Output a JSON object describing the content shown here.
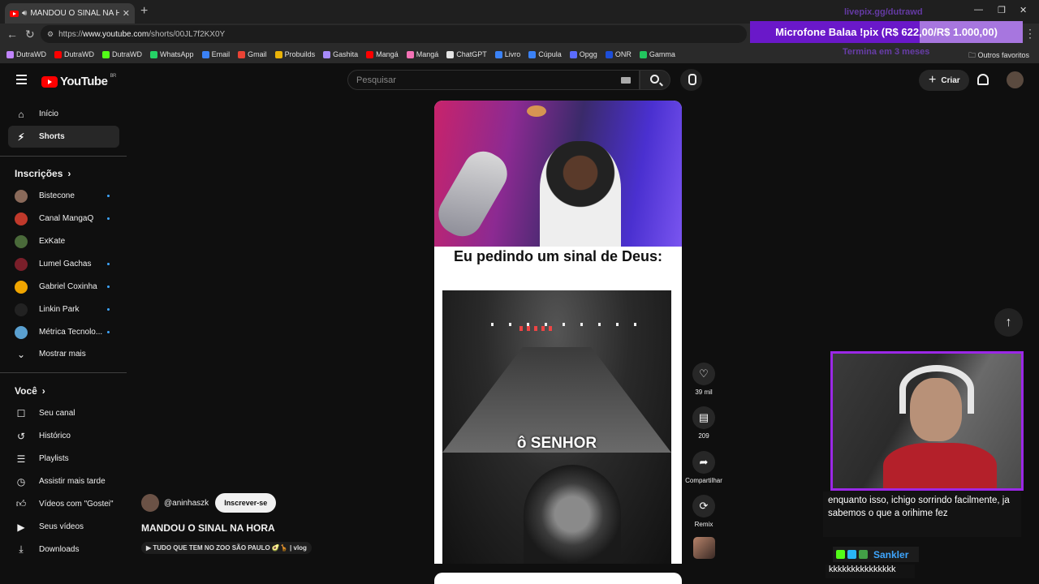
{
  "browser": {
    "tab_title": "MANDOU O SINAL NA HORA",
    "url_prefix": "https://",
    "url_host": "www.youtube.com",
    "url_path": "/shorts/00JL7f2KX0Y",
    "bookmarks": [
      {
        "label": "DutraWD",
        "color": "#c084fc"
      },
      {
        "label": "DutraWD",
        "color": "#ff0000"
      },
      {
        "label": "DutraWD",
        "color": "#53fc18"
      },
      {
        "label": "WhatsApp",
        "color": "#25d366"
      },
      {
        "label": "Email",
        "color": "#3b82f6"
      },
      {
        "label": "Gmail",
        "color": "#ea4335"
      },
      {
        "label": "Probuilds",
        "color": "#eab308"
      },
      {
        "label": "Gashita",
        "color": "#a78bfa"
      },
      {
        "label": "Mangá",
        "color": "#ff0000"
      },
      {
        "label": "Mangá",
        "color": "#f472b6"
      },
      {
        "label": "ChatGPT",
        "color": "#e5e5e5"
      },
      {
        "label": "Livro",
        "color": "#3b82f6"
      },
      {
        "label": "Cúpula",
        "color": "#3b82f6"
      },
      {
        "label": "Opgg",
        "color": "#5b6cff"
      },
      {
        "label": "ONR",
        "color": "#1d4ed8"
      },
      {
        "label": "Gamma",
        "color": "#22c55e"
      }
    ],
    "other_favorites": "Outros favoritos"
  },
  "overlay": {
    "donation_text": "Microfone Balaa !pix (R$ 622,00/R$ 1.000,00)",
    "donation_progress": 0.622,
    "ghost_top": "livepix.gg/dutrawd",
    "ghost_bottom": "Termina em 3 meses"
  },
  "header": {
    "logo": "YouTube",
    "country": "BR",
    "search_placeholder": "Pesquisar",
    "create_label": "Criar"
  },
  "sidebar": {
    "main": [
      {
        "label": "Início",
        "icon": "home-icon"
      },
      {
        "label": "Shorts",
        "icon": "shorts-icon"
      }
    ],
    "subs_heading": "Inscrições",
    "subscriptions": [
      {
        "label": "Bistecone",
        "color": "#8a6a5a",
        "new": true
      },
      {
        "label": "Canal MangaQ",
        "color": "#c0392b",
        "new": true
      },
      {
        "label": "ExKate",
        "color": "#4a6a3a",
        "new": false
      },
      {
        "label": "Lumel Gachas",
        "color": "#7a1f2a",
        "new": true
      },
      {
        "label": "Gabriel Coxinha",
        "color": "#f0a500",
        "new": true
      },
      {
        "label": "Linkin Park",
        "color": "#222222",
        "new": true
      },
      {
        "label": "Métrica Tecnolo...",
        "color": "#5aa0d0",
        "new": true
      }
    ],
    "show_more": "Mostrar mais",
    "you_heading": "Você",
    "you": [
      {
        "label": "Seu canal",
        "icon": "channel-icon"
      },
      {
        "label": "Histórico",
        "icon": "history-icon"
      },
      {
        "label": "Playlists",
        "icon": "playlist-icon"
      },
      {
        "label": "Assistir mais tarde",
        "icon": "clock-icon"
      },
      {
        "label": "Vídeos com \"Gostei\"",
        "icon": "thumb-up-icon"
      },
      {
        "label": "Seus vídeos",
        "icon": "video-icon"
      },
      {
        "label": "Downloads",
        "icon": "download-icon"
      }
    ]
  },
  "short": {
    "meme_caption": "Eu pedindo um sinal de Deus:",
    "subtitle": "ô SENHOR",
    "channel": "@aninhaszk",
    "subscribe_label": "Inscrever-se",
    "title": "MANDOU O SINAL NA HORA",
    "linked_video": "▶ TUDO QUE TEM NO ZOO SÃO PAULO 🥑🦒 | vlog"
  },
  "actions": {
    "likes": "39 mil",
    "comments": "209",
    "share": "Compartilhar",
    "remix": "Remix"
  },
  "chat": {
    "message": "enquanto isso, ichigo sorrindo facilmente, ja sabemos o que a orihime fez",
    "username": "Sankler",
    "username_message": "kkkkkkkkkkkkkkk"
  }
}
